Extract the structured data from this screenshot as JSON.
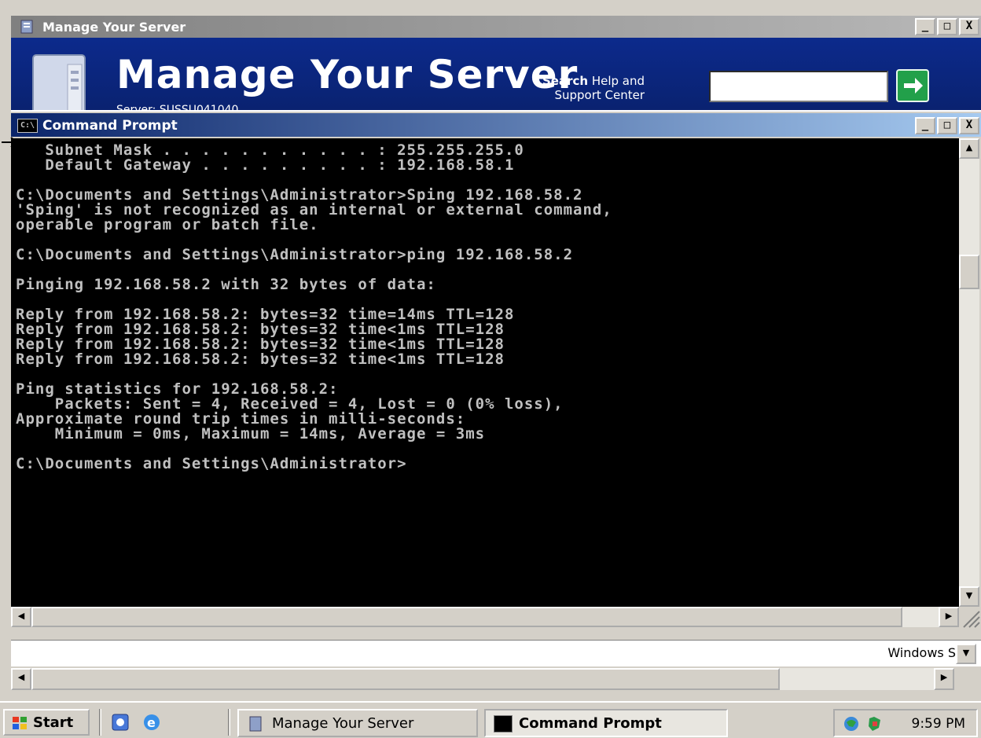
{
  "manage_window": {
    "title": "Manage Your Server",
    "heading": "Manage Your Server",
    "subtext": "Server: SUSSU041040",
    "search_label_bold": "Search",
    "search_label_rest": " Help and",
    "search_label_line2": "Support Center",
    "search_value": "",
    "minimize_label": "_",
    "maximize_label": "□",
    "close_label": "X"
  },
  "cmd_window": {
    "title": "Command Prompt",
    "icon_text": "C:\\",
    "minimize_label": "_",
    "maximize_label": "□",
    "close_label": "X",
    "console_lines": [
      "   Subnet Mask . . . . . . . . . . . : 255.255.255.0",
      "   Default Gateway . . . . . . . . . : 192.168.58.1",
      "",
      "C:\\Documents and Settings\\Administrator>Sping 192.168.58.2",
      "'Sping' is not recognized as an internal or external command,",
      "operable program or batch file.",
      "",
      "C:\\Documents and Settings\\Administrator>ping 192.168.58.2",
      "",
      "Pinging 192.168.58.2 with 32 bytes of data:",
      "",
      "Reply from 192.168.58.2: bytes=32 time=14ms TTL=128",
      "Reply from 192.168.58.2: bytes=32 time<1ms TTL=128",
      "Reply from 192.168.58.2: bytes=32 time<1ms TTL=128",
      "Reply from 192.168.58.2: bytes=32 time<1ms TTL=128",
      "",
      "Ping statistics for 192.168.58.2:",
      "    Packets: Sent = 4, Received = 4, Lost = 0 (0% loss),",
      "Approximate round trip times in milli-seconds:",
      "    Minimum = 0ms, Maximum = 14ms, Average = 3ms",
      "",
      "C:\\Documents and Settings\\Administrator>"
    ],
    "console_text_color": "#c0c0c0",
    "console_bg_color": "#000000"
  },
  "lower_pane": {
    "windows_label": "Windows S"
  },
  "taskbar": {
    "start_label": "Start",
    "tasks": [
      {
        "label": "Manage Your Server",
        "active": false
      },
      {
        "label": "Command Prompt",
        "active": true
      }
    ],
    "clock": "9:59 PM",
    "icons": [
      "ie-icon",
      "quicklaunch-icon",
      "network-tray-icon",
      "security-tray-icon"
    ]
  },
  "colors": {
    "titlebar_active": "#0a246a",
    "banner_blue": "#0c2a8c",
    "go_green": "#22a04a"
  }
}
